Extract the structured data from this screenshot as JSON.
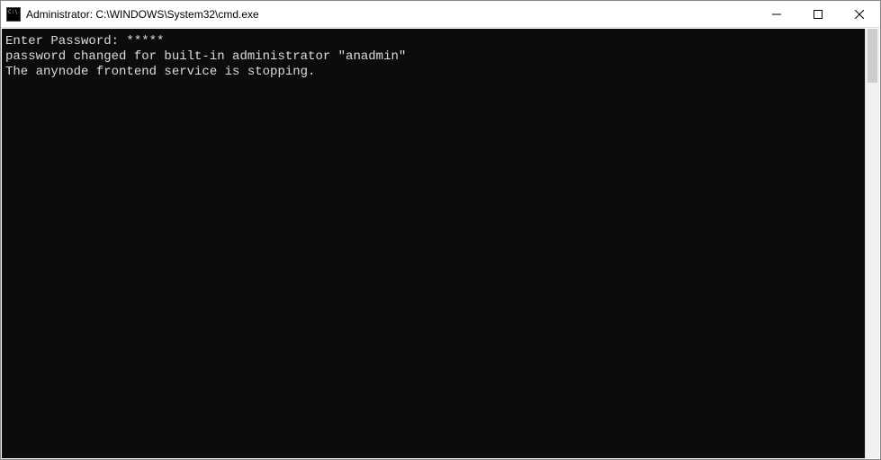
{
  "window": {
    "title": "Administrator: C:\\WINDOWS\\System32\\cmd.exe"
  },
  "console": {
    "lines": [
      "Enter Password: *****",
      "password changed for built-in administrator \"anadmin\"",
      "The anynode frontend service is stopping."
    ]
  }
}
